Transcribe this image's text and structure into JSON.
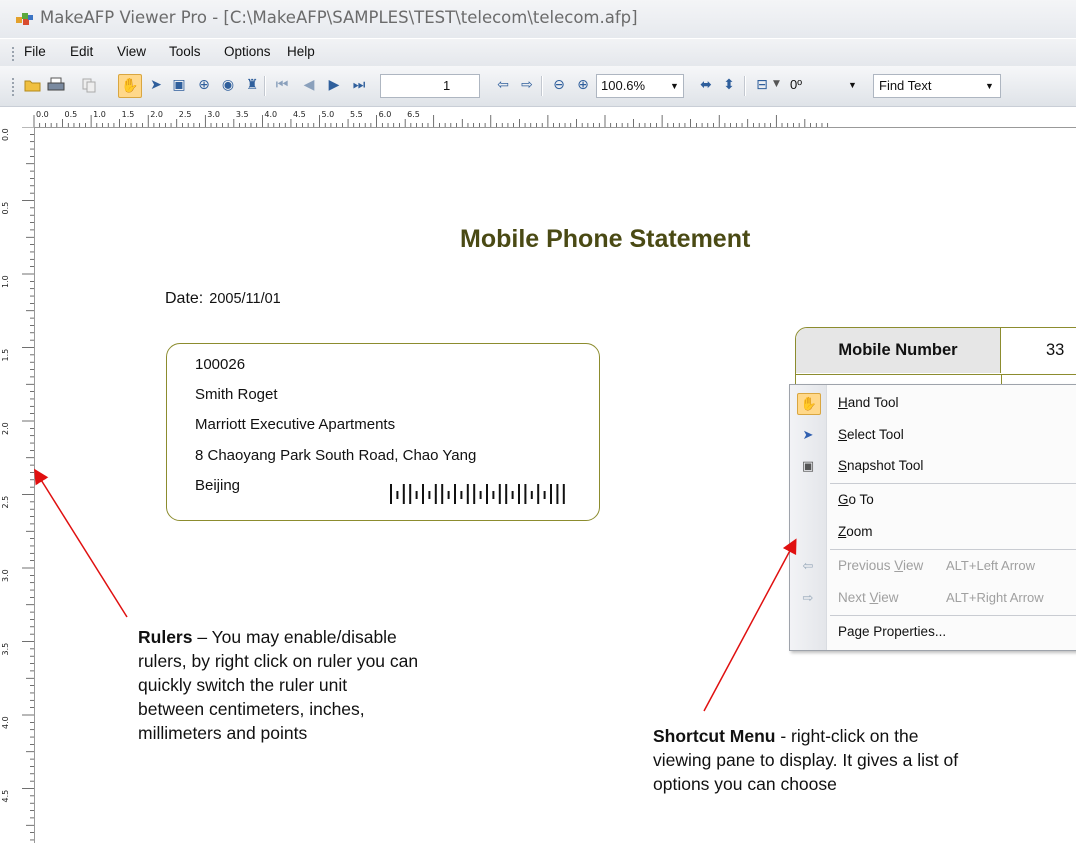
{
  "window": {
    "app_name": "MakeAFP Viewer Pro",
    "title_sep": " - ",
    "file_path": "[C:\\MakeAFP\\SAMPLES\\TEST\\telecom\\telecom.afp]"
  },
  "menu": [
    "File",
    "Edit",
    "View",
    "Tools",
    "Options",
    "Help"
  ],
  "toolbar": {
    "page_number": "1",
    "zoom": "100.6%",
    "rotation": "0º",
    "find_text": "Find Text"
  },
  "ruler": {
    "top_labels": [
      "0.0",
      "0.5",
      "1.0",
      "1.5",
      "2.0",
      "2.5",
      "3.0",
      "3.5",
      "4.0",
      "4.5",
      "5.0",
      "5.5",
      "6.0",
      "6.5"
    ],
    "left_labels": [
      "0.0",
      "0.5",
      "1.0",
      "1.5",
      "2.0",
      "2.5",
      "3.0",
      "3.5",
      "4.0",
      "4.5"
    ]
  },
  "document": {
    "title": "Mobile Phone Statement",
    "date_label": "Date:",
    "date_value": "2005/11/01",
    "address_lines": [
      "100026",
      "Smith Roget",
      "Marriott Executive Apartments",
      "8 Chaoyang Park South Road, Chao Yang",
      "Beijing"
    ],
    "mobile_label": "Mobile Number",
    "mobile_value": "33"
  },
  "context_menu": {
    "items": [
      {
        "icon": "hand-icon",
        "mnemonic": "H",
        "rest": "and Tool",
        "shortcut": "",
        "enabled": true
      },
      {
        "icon": "select-arrow-icon",
        "mnemonic": "S",
        "rest": "elect Tool",
        "shortcut": "",
        "enabled": true
      },
      {
        "icon": "snapshot-icon",
        "mnemonic": "S",
        "rest": "napshot Tool",
        "shortcut": "",
        "enabled": true
      },
      {
        "icon": "",
        "mnemonic": "G",
        "rest": "o To",
        "shortcut": "",
        "enabled": true
      },
      {
        "icon": "",
        "mnemonic": "Z",
        "rest": "oom",
        "shortcut": "",
        "enabled": true
      },
      {
        "icon": "previous-view-icon",
        "pre": "Previous ",
        "mnemonic": "V",
        "rest": "iew",
        "shortcut": "ALT+Left Arrow",
        "enabled": false
      },
      {
        "icon": "next-view-icon",
        "pre": "Next ",
        "mnemonic": "V",
        "rest": "iew",
        "shortcut": "ALT+Right Arrow",
        "enabled": false
      },
      {
        "icon": "",
        "pre": "Pa",
        "mnemonic": "g",
        "rest": "e Properties...",
        "shortcut": "",
        "enabled": true
      }
    ]
  },
  "annotations": {
    "rulers": {
      "heading": "Rulers",
      "lines": [
        " – You may enable/disable",
        "rulers, by right click on ruler you can",
        "quickly switch the ruler unit",
        "between centimeters, inches,",
        "millimeters and points"
      ]
    },
    "shortcut": {
      "heading": "Shortcut Menu",
      "lines": [
        " - right-click on the",
        "viewing pane to display. It gives a list of",
        "options you can choose"
      ]
    }
  },
  "colors": {
    "title_olive": "#4a4a14",
    "box_border": "#8c8c2e",
    "arrow_red": "#e01010",
    "highlight": "#ffd88a"
  }
}
